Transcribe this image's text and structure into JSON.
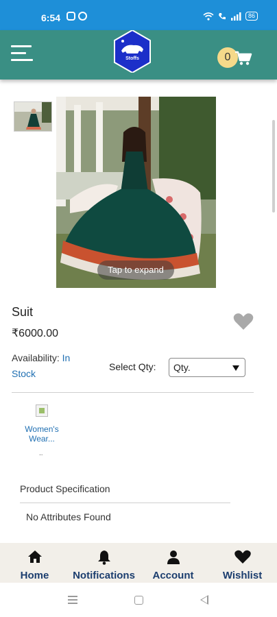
{
  "status_bar": {
    "time": "6:54",
    "battery": "86"
  },
  "header": {
    "logo_text": "Stoffs",
    "cart_count": "0"
  },
  "product": {
    "image_overlay": "Tap to expand",
    "name": "Suit",
    "price": "₹6000.00",
    "availability_label": "Availability:",
    "availability_value": "In Stock",
    "qty_label": "Select Qty:",
    "qty_value": "Qty."
  },
  "category": {
    "label": "Women's Wear...",
    "more": ".."
  },
  "specification": {
    "title": "Product Specification",
    "value": "No Attributes Found"
  },
  "bottom_nav": {
    "items": [
      {
        "label": "Home",
        "icon": "home-icon"
      },
      {
        "label": "Notifications",
        "icon": "bell-icon"
      },
      {
        "label": "Account",
        "icon": "user-icon"
      },
      {
        "label": "Wishlist",
        "icon": "heart-icon"
      }
    ]
  },
  "colors": {
    "status_bar": "#1e8fd8",
    "app_bar": "#3a8f84",
    "link_blue": "#1f6fb2",
    "nav_text": "#1b3d6e",
    "cart_badge": "#f5d98a"
  }
}
